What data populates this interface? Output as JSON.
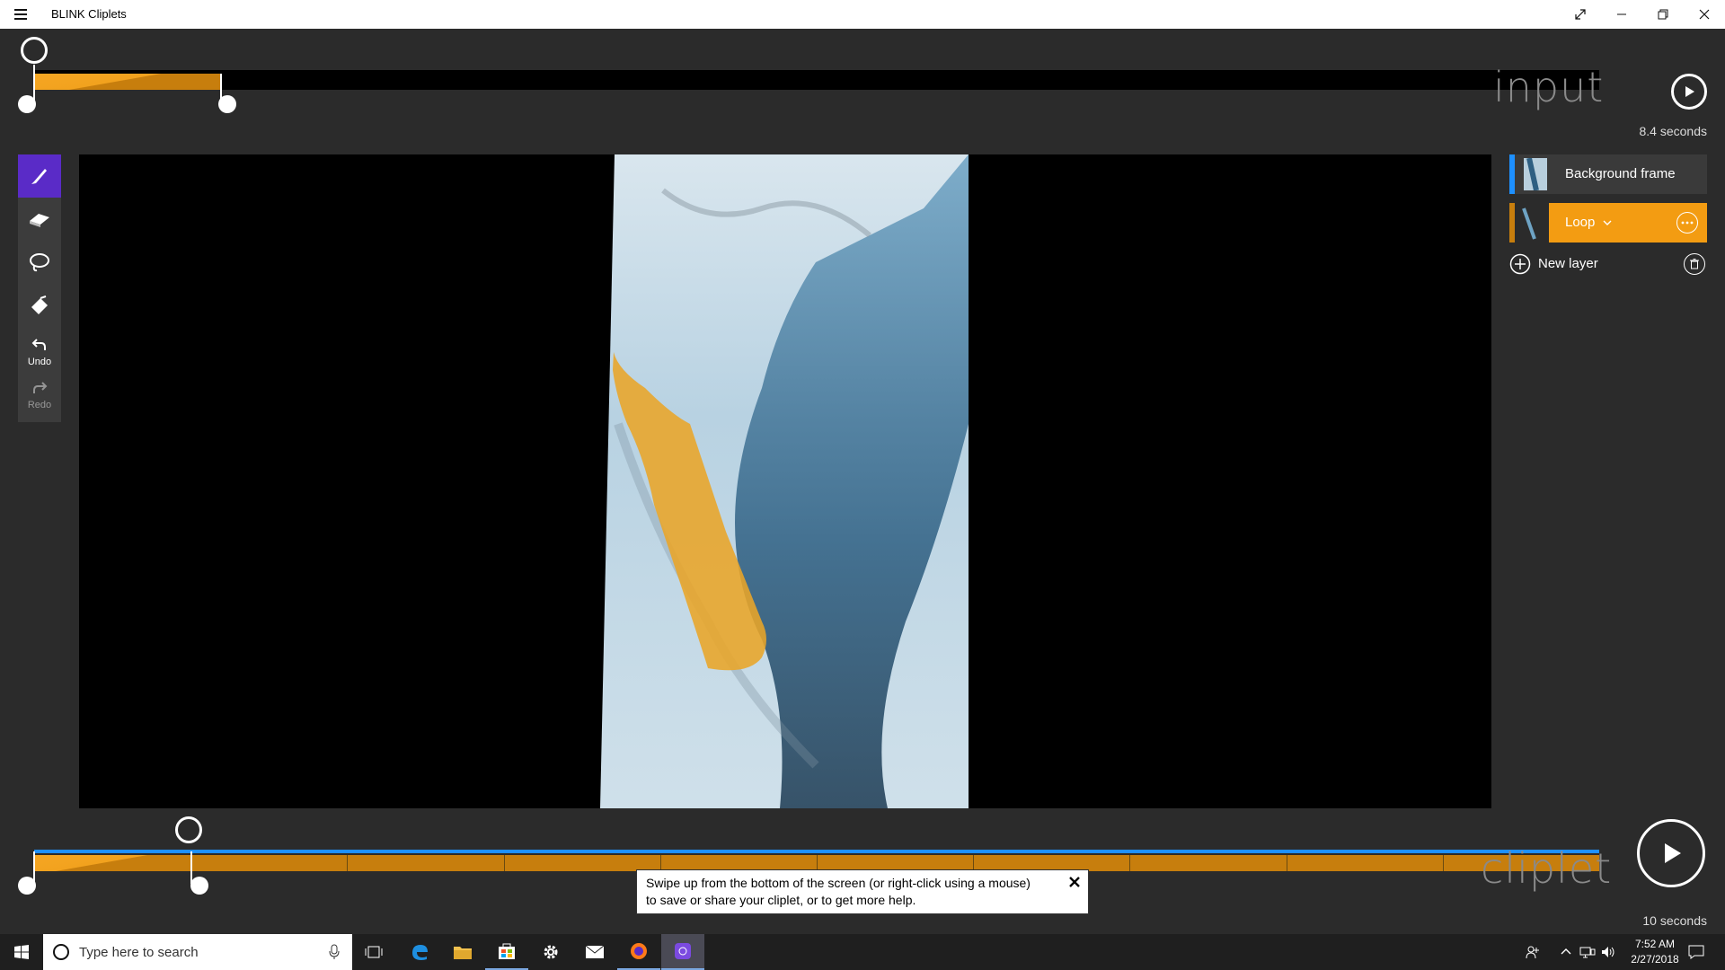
{
  "window": {
    "title": "BLINK Cliplets"
  },
  "input_timeline": {
    "label": "input",
    "duration_text": "8.4 seconds",
    "selection_fraction": [
      0.0,
      0.12
    ],
    "playhead_fraction": 0.0
  },
  "tools": {
    "items": [
      {
        "name": "brush",
        "active": true
      },
      {
        "name": "eraser",
        "active": false
      },
      {
        "name": "lasso",
        "active": false
      },
      {
        "name": "fill",
        "active": false
      }
    ],
    "undo_label": "Undo",
    "redo_label": "Redo"
  },
  "layers": {
    "items": [
      {
        "label": "Background frame",
        "accent": "#1e90ff",
        "selected": false
      },
      {
        "label": "Loop",
        "accent": "#f39c12",
        "selected": true
      }
    ],
    "new_layer_label": "New layer"
  },
  "cliplet_timeline": {
    "label": "cliplet",
    "duration_text": "10 seconds",
    "loop_segments": 10,
    "selection_fraction": [
      0.0,
      0.1
    ],
    "playhead_fraction": 0.1
  },
  "tooltip": {
    "line1": "Swipe up from the bottom of the screen (or right-click using a mouse)",
    "line2": "to save or share your cliplet, or to get more help."
  },
  "taskbar": {
    "search_placeholder": "Type here to search",
    "time": "7:52 AM",
    "date": "2/27/2018"
  },
  "colors": {
    "accent_purple": "#5a2bc7",
    "loop_orange": "#f39c12",
    "blue": "#1e90ff"
  }
}
